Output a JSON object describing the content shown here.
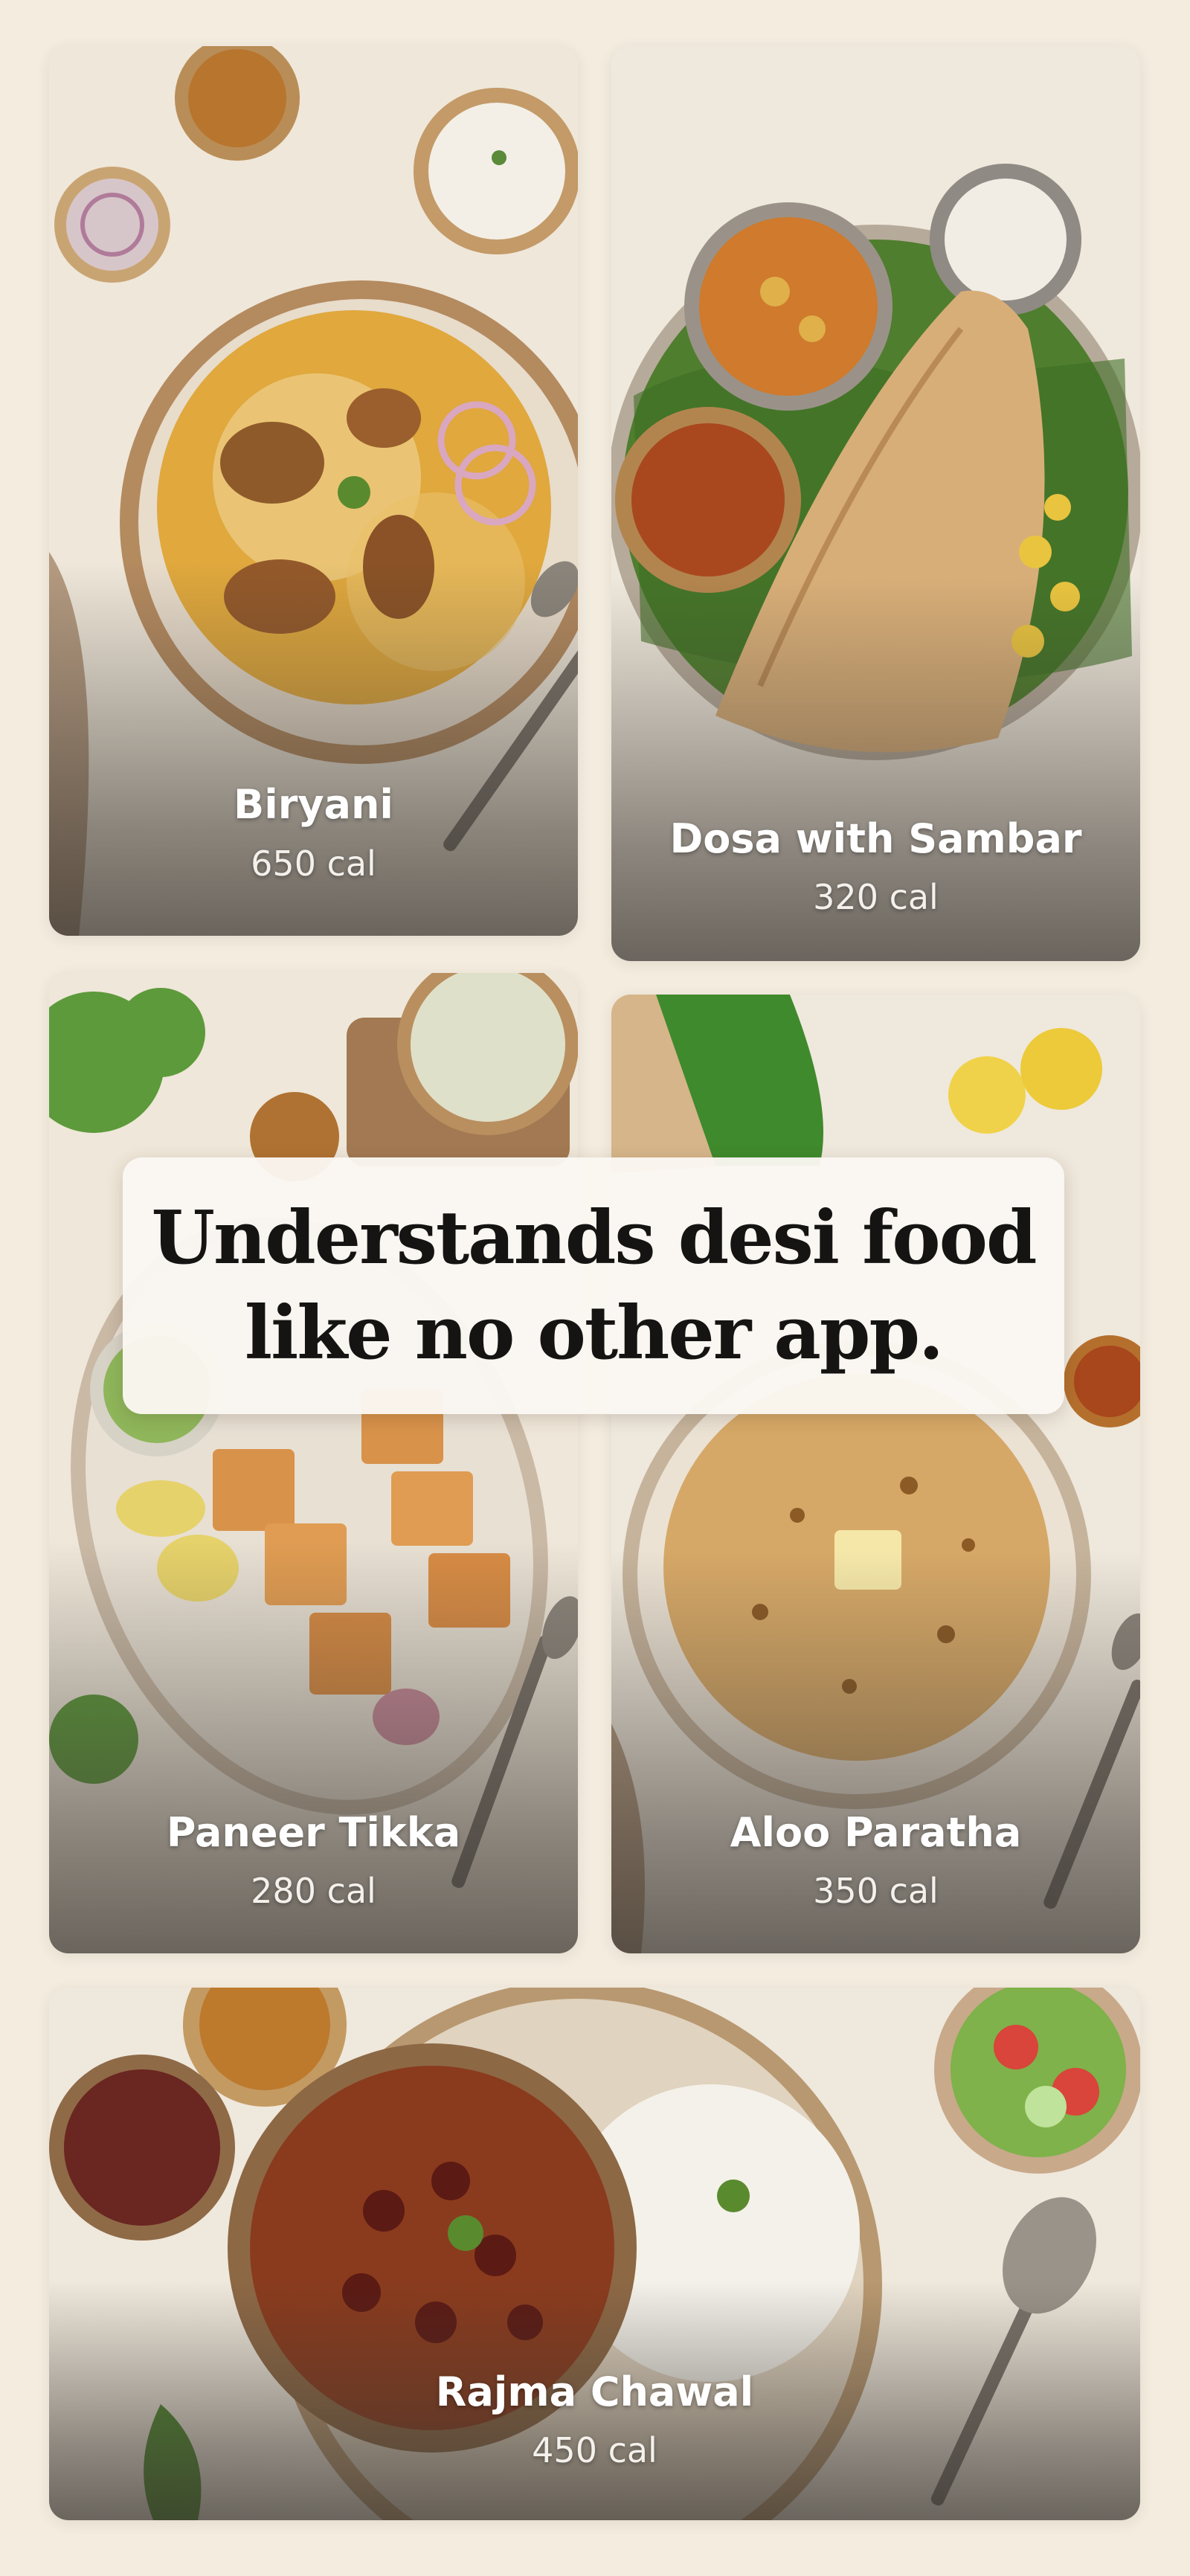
{
  "dishes": [
    {
      "name": "Biryani",
      "calories": "650 cal"
    },
    {
      "name": "Dosa with Sambar",
      "calories": "320 cal"
    },
    {
      "name": "Paneer Tikka",
      "calories": "280 cal"
    },
    {
      "name": "Aloo Paratha",
      "calories": "350 cal"
    },
    {
      "name": "Rajma Chawal",
      "calories": "450 cal"
    }
  ],
  "banner": {
    "line1": "Understands desi food",
    "line2": "like no other app."
  }
}
